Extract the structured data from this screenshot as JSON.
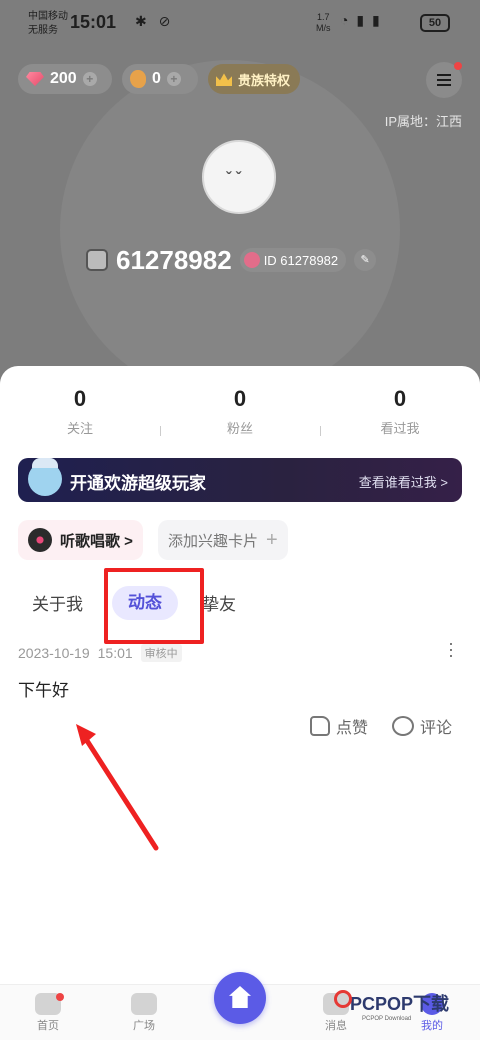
{
  "status_bar": {
    "carrier_line1": "中国移动",
    "carrier_line2": "无服务",
    "time": "15:01",
    "speed_value": "1.7",
    "speed_unit": "M/s",
    "battery": "50"
  },
  "header": {
    "diamonds": "200",
    "beans": "0",
    "noble_label": "贵族特权",
    "ip_location": "IP属地：江西",
    "nickname": "61278982",
    "id_label": "ID 61278982"
  },
  "stats": [
    {
      "value": "0",
      "label": "关注"
    },
    {
      "value": "0",
      "label": "粉丝"
    },
    {
      "value": "0",
      "label": "看过我"
    }
  ],
  "vip_banner": {
    "title": "开通欢游超级玩家",
    "link": "查看谁看过我 >"
  },
  "tags": {
    "music": "听歌唱歌 >",
    "add_interest": "添加兴趣卡片"
  },
  "tabs": {
    "about": "关于我",
    "moments": "动态",
    "friends": "挚友"
  },
  "post": {
    "date": "2023-10-19",
    "time": "15:01",
    "review_status": "审核中",
    "content": "下午好",
    "like_label": "点赞",
    "comment_label": "评论"
  },
  "bottom_nav": {
    "home": "首页",
    "plaza": "广场",
    "messages": "消息",
    "mine": "我的"
  },
  "watermark": {
    "main": "PCPOP下载",
    "sub": "PCPOP Download"
  },
  "colors": {
    "accent": "#5b5be6",
    "highlight": "#ee2121",
    "vip_bg": "#1f2050"
  }
}
